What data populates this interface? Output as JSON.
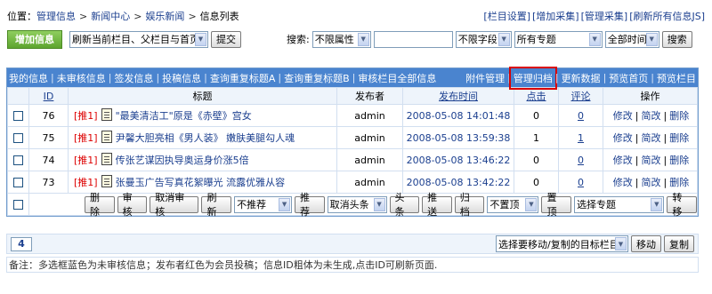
{
  "breadcrumb": {
    "prefix": "位置：",
    "items": [
      "管理信息",
      "新闻中心",
      "娱乐新闻",
      "信息列表"
    ],
    "right_links": [
      "[栏目设置]",
      "[增加采集]",
      "[管理采集]",
      "[刷新所有信息JS]"
    ]
  },
  "toolbar": {
    "add_label": "增加信息",
    "refresh_select": "刷新当前栏目、父栏目与首页",
    "submit_label": "提交",
    "search_label": "搜索:",
    "attr_select": "不限属性",
    "search_value": "",
    "field_select": "不限字段",
    "topic_select": "所有专题",
    "time_select": "全部时间",
    "search_button": "搜索"
  },
  "tabs": {
    "left": [
      "我的信息",
      "未审核信息",
      "签发信息",
      "投稿信息",
      "查询重复标题A",
      "查询重复标题B",
      "审核栏目全部信息"
    ],
    "right": [
      "附件管理",
      "管理归档",
      "更新数据",
      "预览首页",
      "预览栏目"
    ]
  },
  "table": {
    "headers": {
      "id": "ID",
      "title": "标题",
      "publisher": "发布者",
      "time": "发布时间",
      "clicks": "点击",
      "comments": "评论",
      "ops": "操作"
    },
    "rows": [
      {
        "id": "76",
        "tag": "[推1]",
        "title": "\"最美清洁工\"原是《赤壁》宫女",
        "publisher": "admin",
        "time": "2008-05-08 14:01:48",
        "clicks": "0",
        "comments": "0"
      },
      {
        "id": "75",
        "tag": "[推1]",
        "title": "尹馨大胆亮相《男人装》 嫩肤美腿勾人魂",
        "publisher": "admin",
        "time": "2008-05-08 13:59:38",
        "clicks": "1",
        "comments": "1"
      },
      {
        "id": "74",
        "tag": "[推1]",
        "title": "传张艺谋因执导奥运身价涨5倍",
        "publisher": "admin",
        "time": "2008-05-08 13:46:22",
        "clicks": "0",
        "comments": "0"
      },
      {
        "id": "73",
        "tag": "[推1]",
        "title": "张曼玉广告写真花絮曝光 流露优雅从容",
        "publisher": "admin",
        "time": "2008-05-08 13:42:22",
        "clicks": "0",
        "comments": "0"
      }
    ],
    "ops": [
      "修改",
      "简改",
      "删除"
    ],
    "ops_sep": "|"
  },
  "actions": {
    "delete": "删除",
    "review": "审核",
    "cancel_review": "取消审核",
    "refresh": "刷新",
    "recommend_select": "不推荐",
    "recommend": "推荐",
    "headline_select": "取消头条",
    "headline": "头条",
    "push": "推送",
    "archive": "归档",
    "top_select": "不置顶",
    "top": "置顶",
    "topic_select": "选择专题",
    "move_topic": "转移"
  },
  "pager": {
    "page": "4",
    "target_select": "选择要移动/复制的目标栏目",
    "move": "移动",
    "copy": "复制"
  },
  "note": "备注：多选框蓝色为未审核信息；发布者红色为会员投稿；信息ID粗体为未生成,点击ID可刷新页面."
}
